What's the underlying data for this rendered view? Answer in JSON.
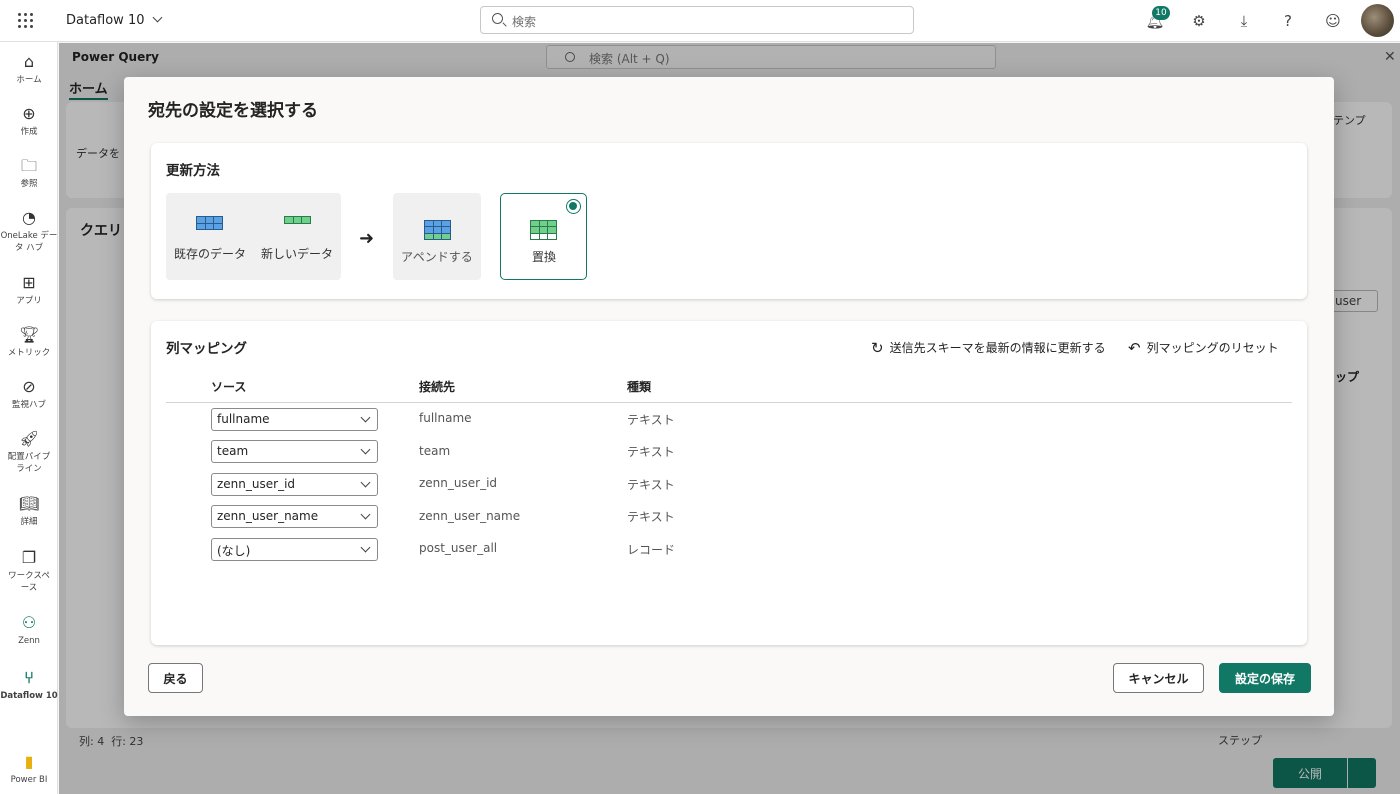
{
  "topbar": {
    "app_title": "Dataflow 10",
    "search_placeholder": "検索",
    "notifications_count": "10"
  },
  "leftnav": {
    "items": [
      {
        "label": "ホーム",
        "icon": "home-icon"
      },
      {
        "label": "作成",
        "icon": "create-icon"
      },
      {
        "label": "参照",
        "icon": "browse-icon"
      },
      {
        "label": "OneLake データ ハブ",
        "icon": "onelake-icon"
      },
      {
        "label": "アプリ",
        "icon": "apps-icon"
      },
      {
        "label": "メトリック",
        "icon": "metrics-icon"
      },
      {
        "label": "監視ハブ",
        "icon": "monitor-icon"
      },
      {
        "label": "配置パイプライン",
        "icon": "pipeline-icon"
      },
      {
        "label": "詳細",
        "icon": "learn-icon"
      },
      {
        "label": "ワークスペース",
        "icon": "workspace-icon"
      },
      {
        "label": "Zenn",
        "icon": "zenn-workspace-icon"
      },
      {
        "label": "Dataflow 10",
        "icon": "dataflow-icon"
      },
      {
        "label": "Power BI",
        "icon": "powerbi-icon"
      }
    ]
  },
  "powerquery": {
    "title": "Power Query",
    "search_placeholder": "検索 (Alt + Q)",
    "home_tab": "ホーム",
    "ribbon_get_data": "データを",
    "ribbon_template": "テンプ",
    "queries_title": "クエリ",
    "user_button": "user",
    "steps_label": "ップ",
    "status_columns": "列: 4",
    "status_rows": "行: 23",
    "status_step": "ステップ",
    "publish_label": "公開"
  },
  "dialog": {
    "title": "宛先の設定を選択する",
    "update_method": {
      "title": "更新方法",
      "existing_label": "既存のデータ",
      "new_label": "新しいデータ",
      "append_label": "アペンドする",
      "replace_label": "置換",
      "selected": "置換"
    },
    "mapping": {
      "title": "列マッピング",
      "refresh_schema": "送信先スキーマを最新の情報に更新する",
      "reset_mapping": "列マッピングのリセット",
      "headers": {
        "source": "ソース",
        "destination": "接続先",
        "type": "種類"
      },
      "rows": [
        {
          "source": "fullname",
          "destination": "fullname",
          "type": "テキスト"
        },
        {
          "source": "team",
          "destination": "team",
          "type": "テキスト"
        },
        {
          "source": "zenn_user_id",
          "destination": "zenn_user_id",
          "type": "テキスト"
        },
        {
          "source": "zenn_user_name",
          "destination": "zenn_user_name",
          "type": "テキスト"
        },
        {
          "source": "(なし)",
          "destination": "post_user_all",
          "type": "レコード"
        }
      ]
    },
    "buttons": {
      "back": "戻る",
      "cancel": "キャンセル",
      "save": "設定の保存"
    }
  },
  "colors": {
    "accent": "#117865",
    "table_blue": "#5aa2e6",
    "table_green": "#6fd08c"
  }
}
